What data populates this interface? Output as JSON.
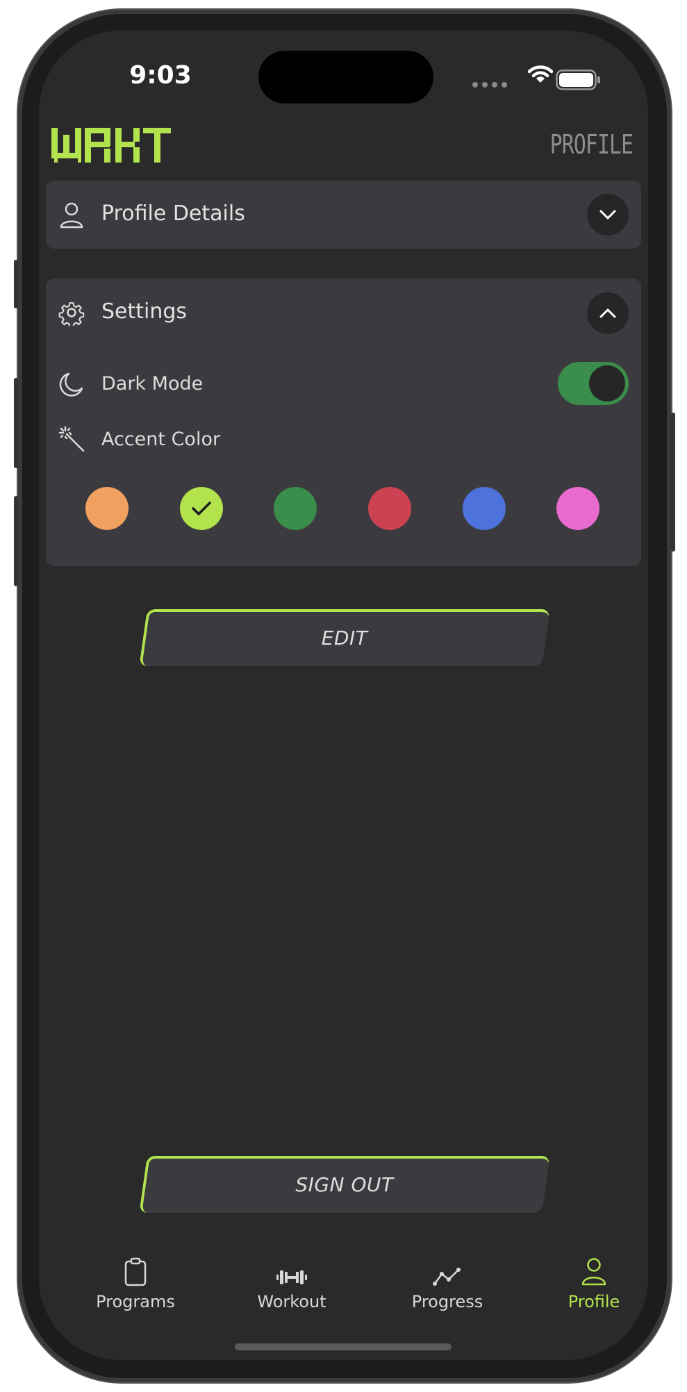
{
  "status_bar": {
    "time": "9:03"
  },
  "header": {
    "logo_text": "WRKT",
    "page_title": "PROFILE"
  },
  "profile_details": {
    "title": "Profile Details",
    "expanded": false
  },
  "settings": {
    "title": "Settings",
    "expanded": true,
    "dark_mode": {
      "label": "Dark Mode",
      "enabled": true
    },
    "accent_color": {
      "label": "Accent Color",
      "selected": "#b2e34d",
      "options": [
        "#f0a060",
        "#b2e34d",
        "#3a8d4a",
        "#cd4253",
        "#4d72dc",
        "#ea6bcf"
      ]
    }
  },
  "buttons": {
    "edit": "EDIT",
    "sign_out": "SIGN OUT"
  },
  "tabbar": {
    "active": "Profile",
    "tabs": [
      {
        "label": "Programs",
        "icon": "clipboard-icon"
      },
      {
        "label": "Workout",
        "icon": "dumbbell-icon"
      },
      {
        "label": "Progress",
        "icon": "chart-line-icon"
      },
      {
        "label": "Profile",
        "icon": "person-icon"
      }
    ]
  },
  "colors": {
    "accent": "#b2e34d",
    "background": "#2a2a2a",
    "card": "#3b3b3f",
    "toggle_on": "#3a8d4a"
  }
}
